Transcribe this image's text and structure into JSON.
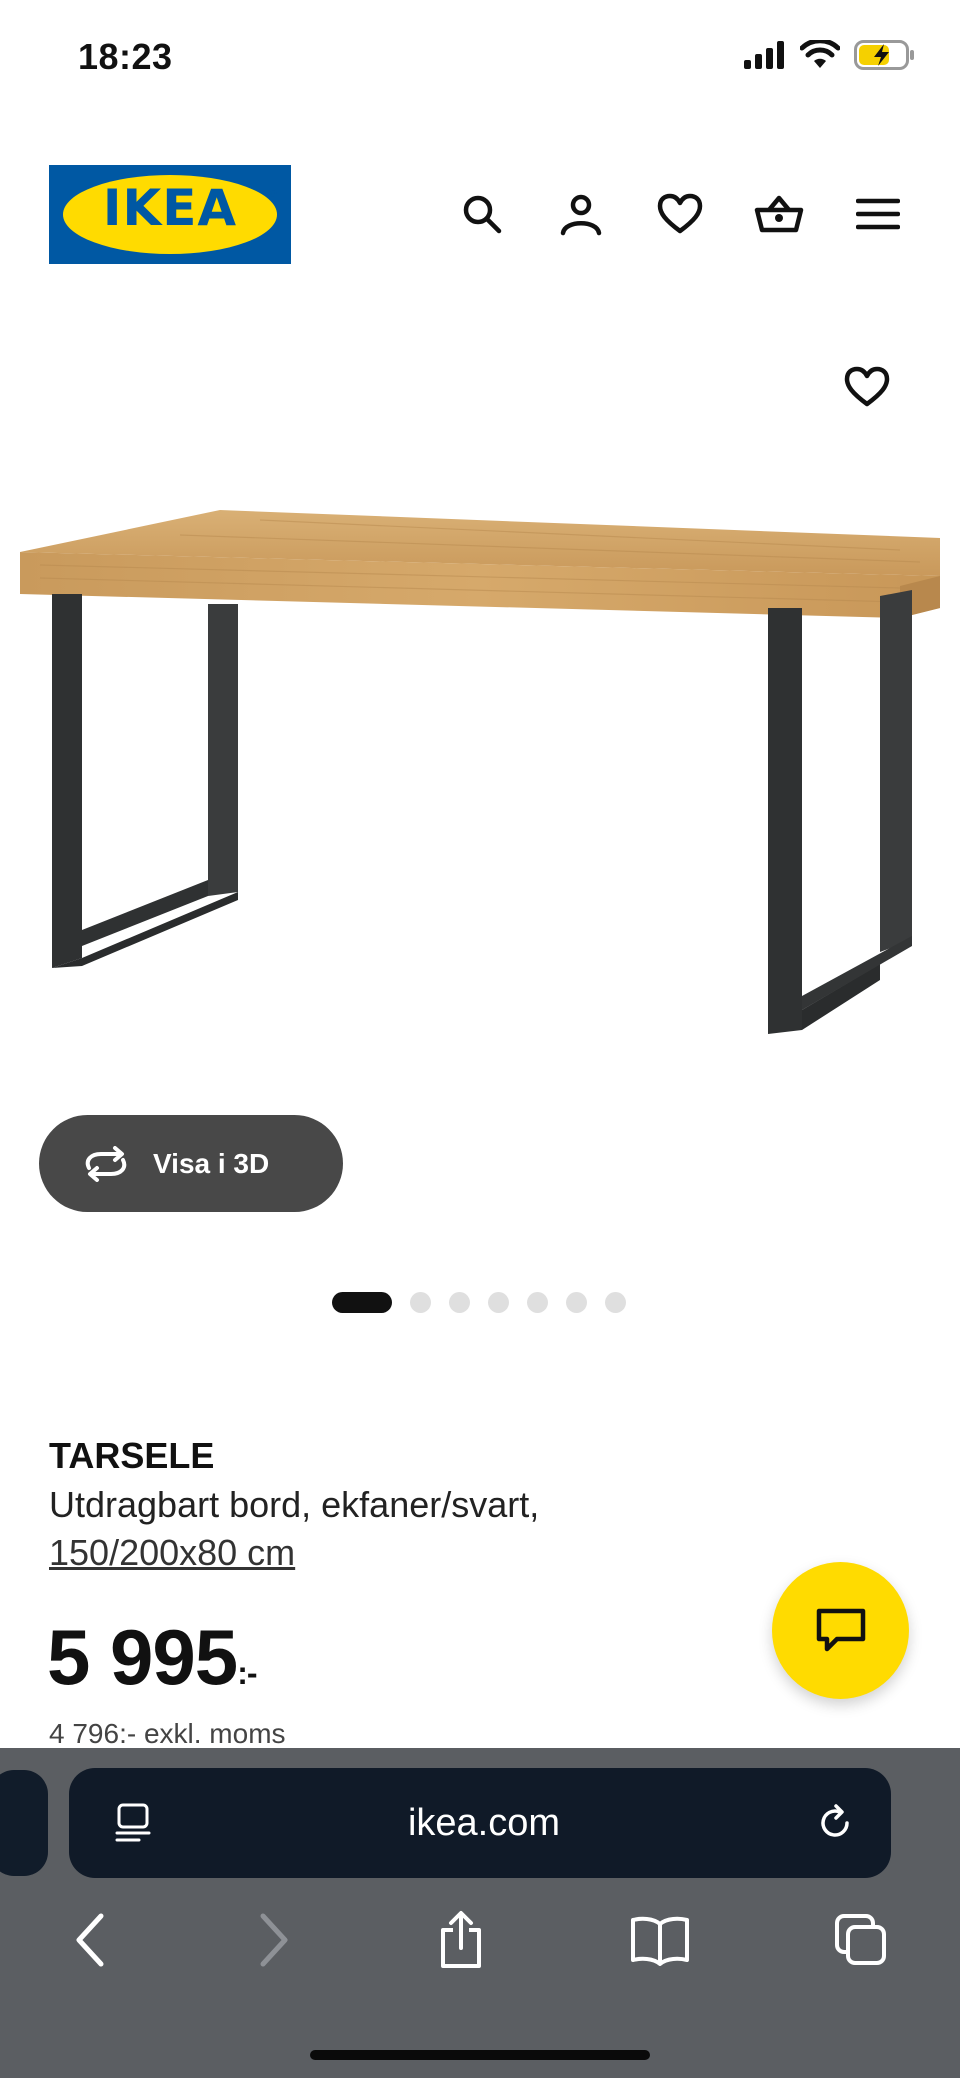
{
  "status_bar": {
    "time": "18:23"
  },
  "header": {
    "logo_text": "IKEA",
    "icons": [
      "search-icon",
      "account-icon",
      "heart-icon",
      "basket-icon",
      "menu-icon"
    ]
  },
  "gallery": {
    "view_3d_label": "Visa i 3D",
    "image_count": 7,
    "active_index": 0
  },
  "product": {
    "name": "TARSELE",
    "description_line1": "Utdragbart bord, ekfaner/svart,",
    "size_link": "150/200x80 cm",
    "price": "5 995",
    "price_suffix": ":-",
    "price_excl_vat": "4 796:- exkl. moms"
  },
  "browser": {
    "url": "ikea.com"
  },
  "colors": {
    "ikea_blue": "#0058a3",
    "ikea_yellow": "#ffdb00",
    "safari_bar": "#5b5e62",
    "url_field": "#101a28"
  }
}
